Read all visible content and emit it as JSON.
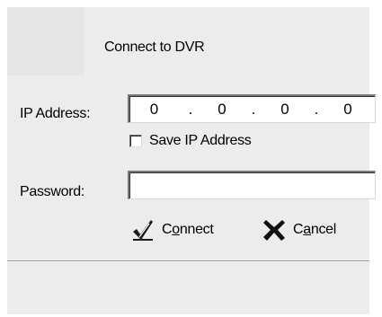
{
  "dialog": {
    "title": "Connect to DVR"
  },
  "ip": {
    "label": "IP Address:",
    "octets": [
      "0",
      "0",
      "0",
      "0"
    ],
    "separator": "."
  },
  "save_ip": {
    "label": "Save IP Address",
    "checked": false
  },
  "password": {
    "label": "Password:",
    "value": ""
  },
  "buttons": {
    "connect": {
      "label_pre": "C",
      "label_accel": "o",
      "label_post": "nnect",
      "icon": "checkmark-pen-icon"
    },
    "cancel": {
      "label_pre": "C",
      "label_accel": "a",
      "label_post": "ncel",
      "icon": "x-cross-icon"
    }
  }
}
